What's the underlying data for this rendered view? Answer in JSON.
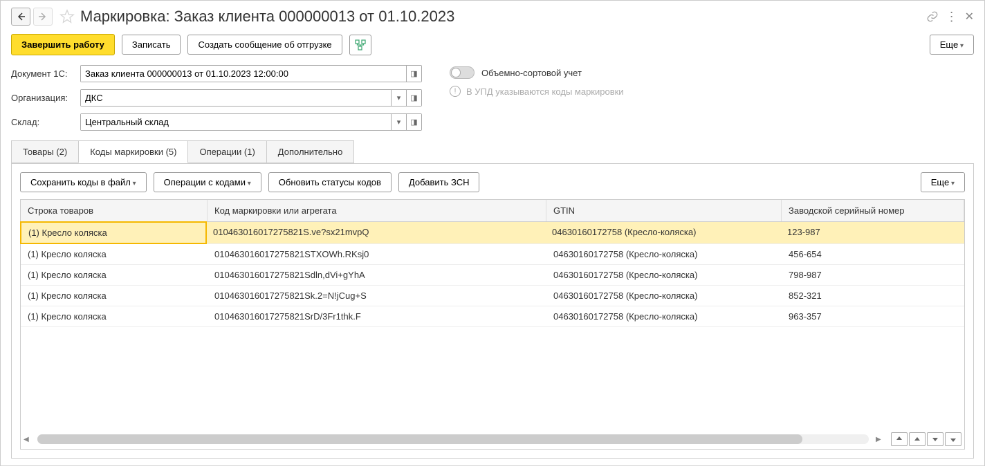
{
  "title": "Маркировка: Заказ клиента 000000013 от 01.10.2023",
  "toolbar": {
    "finish": "Завершить работу",
    "save": "Записать",
    "createShipment": "Создать сообщение об отгрузке",
    "more": "Еще"
  },
  "form": {
    "docLabel": "Документ 1С:",
    "docValue": "Заказ клиента 000000013 от 01.10.2023 12:00:00",
    "orgLabel": "Организация:",
    "orgValue": "ДКС",
    "whLabel": "Склад:",
    "whValue": "Центральный склад",
    "toggleLabel": "Объемно-сортовой учет",
    "infoText": "В УПД указываются коды маркировки"
  },
  "tabs": {
    "goods": "Товары (2)",
    "codes": "Коды маркировки (5)",
    "ops": "Операции (1)",
    "additional": "Дополнительно"
  },
  "tabToolbar": {
    "saveCodes": "Сохранить коды в файл",
    "codeOps": "Операции с кодами",
    "refreshStatus": "Обновить статусы кодов",
    "addZsn": "Добавить ЗСН",
    "more": "Еще"
  },
  "tableHeaders": {
    "line": "Строка товаров",
    "code": "Код маркировки или агрегата",
    "gtin": "GTIN",
    "serial": "Заводской серийный номер"
  },
  "rows": [
    {
      "line": "(1) Кресло коляска",
      "code": "010463016017275821S.ve?sx21mvpQ",
      "gtin": "04630160172758 (Кресло-коляска)",
      "serial": "123-987"
    },
    {
      "line": "(1) Кресло коляска",
      "code": "010463016017275821STXOWh.RKsj0",
      "gtin": "04630160172758 (Кресло-коляска)",
      "serial": "456-654"
    },
    {
      "line": "(1) Кресло коляска",
      "code": "010463016017275821Sdln,dVi+gYhA",
      "gtin": "04630160172758 (Кресло-коляска)",
      "serial": "798-987"
    },
    {
      "line": "(1) Кресло коляска",
      "code": "010463016017275821Sk.2=N!jCug+S",
      "gtin": "04630160172758 (Кресло-коляска)",
      "serial": "852-321"
    },
    {
      "line": "(1) Кресло коляска",
      "code": "010463016017275821SrD/3Fr1thk.F",
      "gtin": "04630160172758 (Кресло-коляска)",
      "serial": "963-357"
    }
  ]
}
